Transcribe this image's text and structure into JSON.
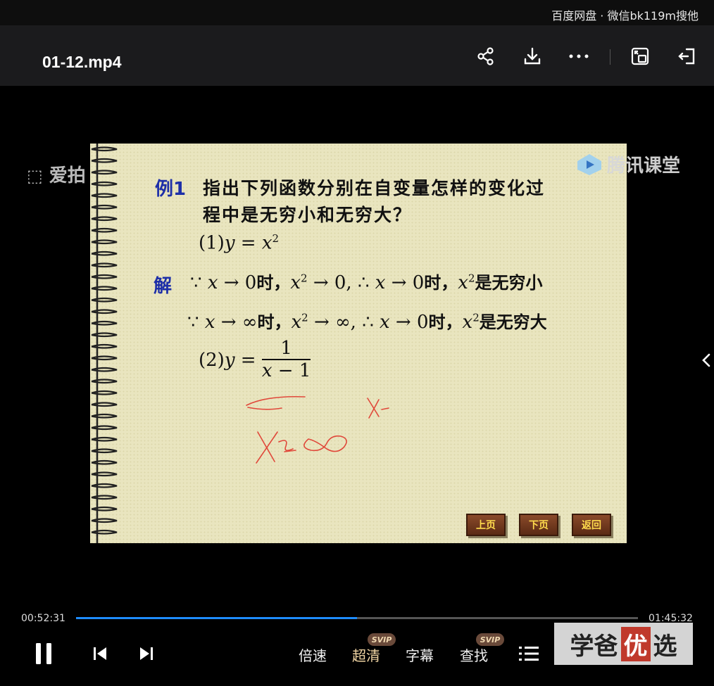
{
  "topbar": {
    "brand": "百度网盘 · 微信bk119m搜他"
  },
  "header": {
    "title": "01-12.mp4"
  },
  "video": {
    "watermark_left": "爱拍",
    "watermark_right": "腾讯课堂",
    "slide": {
      "example_label": "例1",
      "question_line1": "指出下列函数分别在自变量怎样的变化过",
      "question_line2": "程中是无穷小和无穷大？",
      "solution_label": "解",
      "item1": "(1)",
      "item2": "(2)",
      "frac_num": "1",
      "handwriting1": "x→∞",
      "handwriting2": "x-",
      "buttons": {
        "prev": "上页",
        "next": "下页",
        "back": "返回"
      }
    }
  },
  "playback": {
    "current_time": "00:52:31",
    "total_time": "01:45:32",
    "progress": 0.5
  },
  "controls": {
    "speed": "倍速",
    "quality": "超清",
    "subtitle": "字幕",
    "search": "查找",
    "svip_badge": "SVIP"
  },
  "logo_overlay": "学爸优选"
}
